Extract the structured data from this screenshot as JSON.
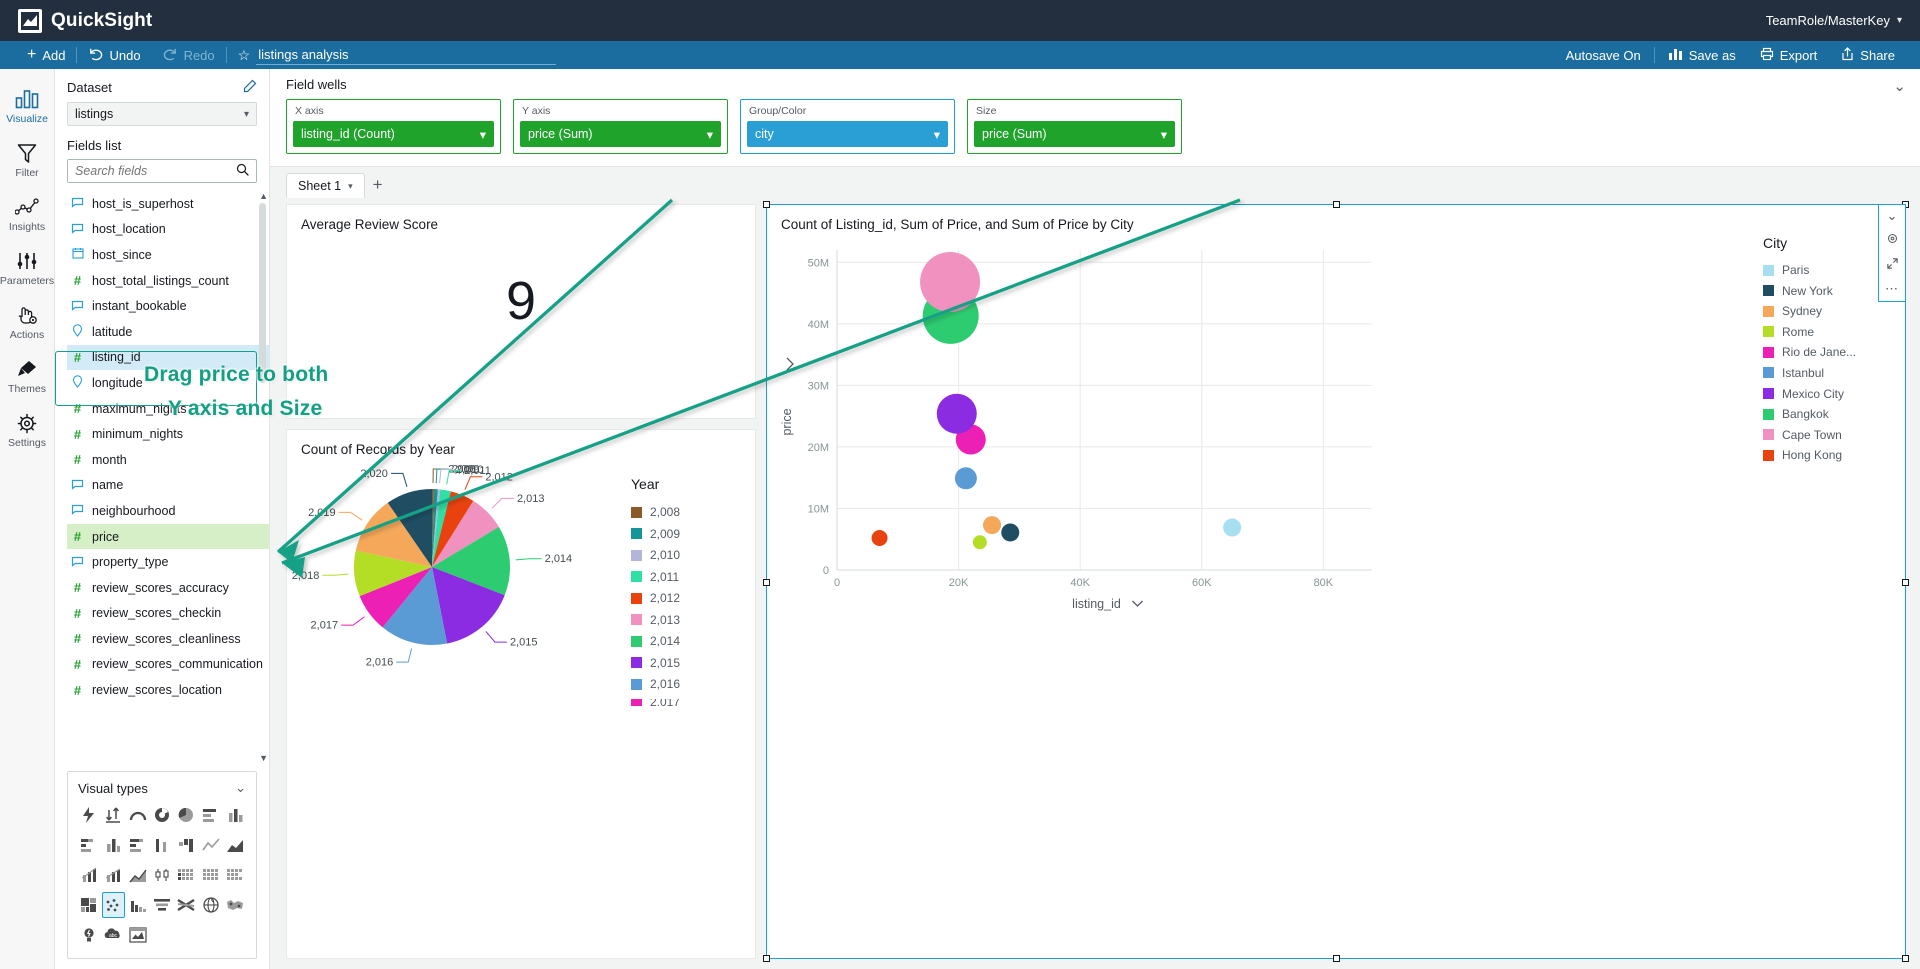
{
  "app": {
    "brand": "QuickSight",
    "user": "TeamRole/MasterKey"
  },
  "actionbar": {
    "add": "Add",
    "undo": "Undo",
    "redo": "Redo",
    "analysis_name": "listings analysis",
    "autosave": "Autosave On",
    "save_as": "Save as",
    "export": "Export",
    "share": "Share"
  },
  "rail": {
    "items": [
      {
        "label": "Visualize",
        "icon": "bar-chart-icon",
        "active": true
      },
      {
        "label": "Filter",
        "icon": "funnel-icon",
        "active": false
      },
      {
        "label": "Insights",
        "icon": "line-nodes-icon",
        "active": false
      },
      {
        "label": "Parameters",
        "icon": "sliders-icon",
        "active": false
      },
      {
        "label": "Actions",
        "icon": "hand-gear-icon",
        "active": false
      },
      {
        "label": "Themes",
        "icon": "paintbrush-icon",
        "active": false
      },
      {
        "label": "Settings",
        "icon": "gear-icon",
        "active": false
      }
    ]
  },
  "fields_panel": {
    "dataset_header": "Dataset",
    "dataset_value": "listings",
    "fields_header": "Fields list",
    "search_placeholder": "Search fields",
    "fields": [
      {
        "name": "host_is_superhost",
        "type": "string"
      },
      {
        "name": "host_location",
        "type": "string"
      },
      {
        "name": "host_since",
        "type": "date"
      },
      {
        "name": "host_total_listings_count",
        "type": "number"
      },
      {
        "name": "instant_bookable",
        "type": "string"
      },
      {
        "name": "latitude",
        "type": "geo"
      },
      {
        "name": "listing_id",
        "type": "number",
        "selected": "blue"
      },
      {
        "name": "longitude",
        "type": "geo"
      },
      {
        "name": "maximum_nights",
        "type": "number"
      },
      {
        "name": "minimum_nights",
        "type": "number"
      },
      {
        "name": "month",
        "type": "number"
      },
      {
        "name": "name",
        "type": "string"
      },
      {
        "name": "neighbourhood",
        "type": "string"
      },
      {
        "name": "price",
        "type": "number",
        "selected": "green"
      },
      {
        "name": "property_type",
        "type": "string"
      },
      {
        "name": "review_scores_accuracy",
        "type": "number"
      },
      {
        "name": "review_scores_checkin",
        "type": "number"
      },
      {
        "name": "review_scores_cleanliness",
        "type": "number"
      },
      {
        "name": "review_scores_communication",
        "type": "number"
      },
      {
        "name": "review_scores_location",
        "type": "number"
      }
    ]
  },
  "visual_types": {
    "header": "Visual types",
    "icons": [
      "autograph-icon",
      "vertical-updown-icon",
      "gauge-icon",
      "donut-icon",
      "pie-icon",
      "horizontal-bar-icon",
      "vertical-bar-icon",
      "stacked-horizontal-bar-icon",
      "clustered-bar-icon",
      "stacked-bar-horizontal-icon",
      "clustered-column-icon",
      "waterfall-icon",
      "line-icon",
      "area-icon",
      "combo-line-bar-icon",
      "combo-area-bar-icon",
      "area-line-icon",
      "boxplot-icon",
      "heatmap-icon",
      "pivot-table-icon",
      "table-icon",
      "treemap-icon",
      "scatter-plot-icon",
      "histogram-icon",
      "funnel-icon",
      "sankey-icon",
      "geospatial-point-icon",
      "filled-map-icon",
      "insight-icon",
      "word-cloud-icon",
      "image-icon"
    ],
    "active_index": 22
  },
  "field_wells": {
    "title": "Field wells",
    "wells": [
      {
        "label": "X axis",
        "value": "listing_id (Count)",
        "color": "green"
      },
      {
        "label": "Y axis",
        "value": "price (Sum)",
        "color": "green"
      },
      {
        "label": "Group/Color",
        "value": "city",
        "color": "blue"
      },
      {
        "label": "Size",
        "value": "price (Sum)",
        "color": "green"
      }
    ]
  },
  "sheets": {
    "tabs": [
      "Sheet 1"
    ],
    "add_label": "+"
  },
  "annotation": {
    "line1": "Drag price to both",
    "line2": "Y axis and Size",
    "color": "#13a085"
  },
  "visuals": {
    "kpi": {
      "title": "Average Review Score",
      "value": "9"
    },
    "pie": {
      "title": "Count of Records by Year",
      "legend_title": "Year"
    },
    "scatter": {
      "title": "Count of Listing_id, Sum of Price, and Sum of Price by City",
      "legend_title": "City",
      "x_field_label": "listing_id",
      "y_field_label": "price"
    }
  },
  "chart_data": [
    {
      "type": "pie",
      "title": "Count of Records by Year",
      "legend_title": "Year",
      "legend_position": "right",
      "labels": [
        "2,008",
        "2,009",
        "2,010",
        "2,011",
        "2,012",
        "2,013",
        "2,014",
        "2,015",
        "2,016",
        "2,017",
        "2,018",
        "2,019",
        "2,020"
      ],
      "values": [
        0.4,
        0.8,
        0.5,
        2.2,
        5.0,
        7.5,
        14.5,
        16.0,
        14.0,
        8.0,
        9.5,
        12.0,
        9.6
      ],
      "colors": [
        "#8b5a2b",
        "#15959a",
        "#b3b6d9",
        "#2ee0a4",
        "#e8430e",
        "#f191c0",
        "#2ecc71",
        "#8b2be2",
        "#5b9bd5",
        "#ec20b4",
        "#b4dd25",
        "#f5a košice",
        "#1f4e63"
      ],
      "slice_colors": [
        "#8b5a2b",
        "#15959a",
        "#b3b6d9",
        "#2ee0a4",
        "#e8430e",
        "#f191c0",
        "#2ecc71",
        "#8b2be2",
        "#5b9bd5",
        "#ec20b4",
        "#b4dd25",
        "#f5a85a",
        "#1f4e63"
      ]
    },
    {
      "type": "scatter",
      "title": "Count of Listing_id, Sum of Price, and Sum of Price by City",
      "xlabel": "listing_id",
      "ylabel": "price",
      "xticks": [
        "0",
        "20K",
        "40K",
        "60K",
        "80K"
      ],
      "yticks": [
        "0",
        "10M",
        "20M",
        "30M",
        "40M",
        "50M"
      ],
      "xlim": [
        0,
        88000
      ],
      "ylim": [
        0,
        52000000
      ],
      "grid": true,
      "legend_title": "City",
      "legend_position": "right",
      "points": [
        {
          "name": "Paris",
          "color": "#a5dff0",
          "x": 65000,
          "y": 6900000,
          "size": 9
        },
        {
          "name": "New York",
          "color": "#1f4e63",
          "x": 28500,
          "y": 6100000,
          "size": 9
        },
        {
          "name": "Sydney",
          "color": "#f5a85a",
          "x": 25500,
          "y": 7300000,
          "size": 9
        },
        {
          "name": "Rome",
          "color": "#b4dd25",
          "x": 23500,
          "y": 4500000,
          "size": 7
        },
        {
          "name": "Rio de Jane...",
          "color": "#ec20b4",
          "x": 22000,
          "y": 21200000,
          "size": 15
        },
        {
          "name": "Istanbul",
          "color": "#5b9bd5",
          "x": 21200,
          "y": 14900000,
          "size": 11
        },
        {
          "name": "Mexico City",
          "color": "#8b2be2",
          "x": 19700,
          "y": 25400000,
          "size": 20
        },
        {
          "name": "Bangkok",
          "color": "#2ecc71",
          "x": 18700,
          "y": 41300000,
          "size": 28
        },
        {
          "name": "Cape Town",
          "color": "#f191c0",
          "x": 18600,
          "y": 46800000,
          "size": 30
        },
        {
          "name": "Hong Kong",
          "color": "#e8430e",
          "x": 7000,
          "y": 5200000,
          "size": 8
        }
      ],
      "legend": [
        {
          "label": "Paris",
          "color": "#a5dff0"
        },
        {
          "label": "New York",
          "color": "#1f4e63"
        },
        {
          "label": "Sydney",
          "color": "#f5a85a"
        },
        {
          "label": "Rome",
          "color": "#b4dd25"
        },
        {
          "label": "Rio de Jane...",
          "color": "#ec20b4"
        },
        {
          "label": "Istanbul",
          "color": "#5b9bd5"
        },
        {
          "label": "Mexico City",
          "color": "#8b2be2"
        },
        {
          "label": "Bangkok",
          "color": "#2ecc71"
        },
        {
          "label": "Cape Town",
          "color": "#f191c0"
        },
        {
          "label": "Hong Kong",
          "color": "#e8430e"
        }
      ]
    },
    {
      "type": "kpi",
      "title": "Average Review Score",
      "value": 9
    }
  ]
}
